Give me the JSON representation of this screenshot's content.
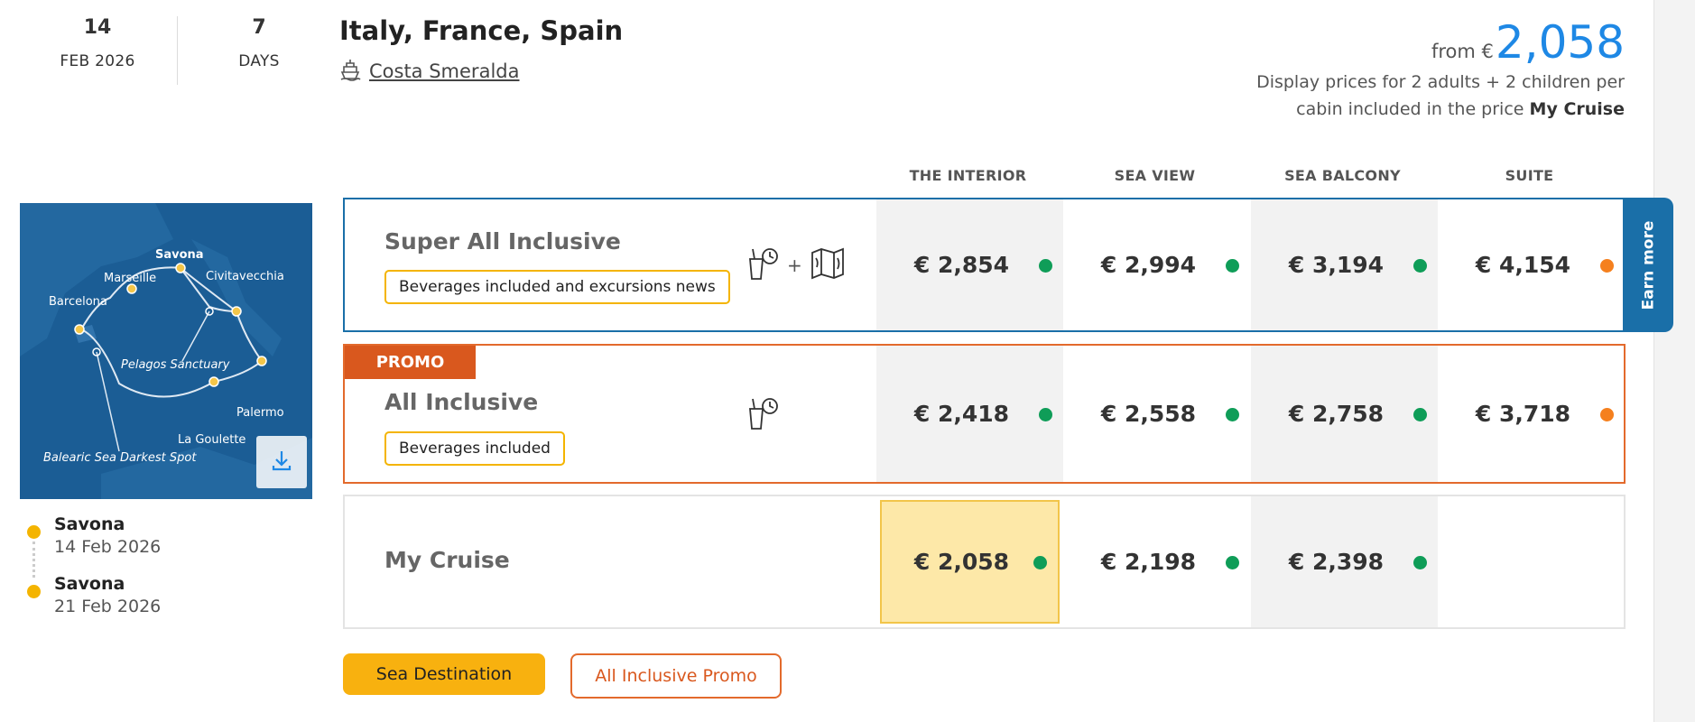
{
  "colors": {
    "accent_blue": "#1e88e5",
    "brand_navy": "#1a6fa8",
    "promo_orange": "#d9581e",
    "tag_yellow": "#f4b400",
    "available_green": "#0f9d58",
    "limited_orange": "#f5801e"
  },
  "header": {
    "departure_day": "14",
    "departure_month": "FEB 2026",
    "duration": "7",
    "duration_unit": "DAYS",
    "title": "Italy, France, Spain",
    "ship_icon": "ship-icon",
    "ship_name": "Costa Smeralda"
  },
  "price_summary": {
    "from_label": "from €",
    "from_price": "2,058",
    "note_text": "Display prices for 2 adults + 2 children per cabin included in the price",
    "note_bold": "My Cruise"
  },
  "columns": [
    "THE INTERIOR",
    "SEA VIEW",
    "SEA BALCONY",
    "SUITE"
  ],
  "map": {
    "labels": {
      "savona": "Savona",
      "marseille": "Marseille",
      "civitavecchia": "Civitavecchia",
      "barcelona": "Barcelona",
      "pelagos": "Pelagos Sanctuary",
      "palermo": "Palermo",
      "goulette": "La Goulette",
      "balearic": "Balearic Sea Darkest Spot"
    },
    "download_icon": "download-icon"
  },
  "itinerary": [
    {
      "port": "Savona",
      "date": "14 Feb 2026"
    },
    {
      "port": "Savona",
      "date": "21 Feb 2026"
    }
  ],
  "packages": {
    "super": {
      "title": "Super All Inclusive",
      "tag": "Beverages included and excursions news",
      "plus": "+",
      "prices": [
        "€ 2,854",
        "€ 2,994",
        "€ 3,194",
        "€ 4,154"
      ],
      "status": [
        "available",
        "available",
        "available",
        "limited"
      ]
    },
    "allinc": {
      "badge": "PROMO",
      "title": "All Inclusive",
      "tag": "Beverages included",
      "prices": [
        "€ 2,418",
        "€ 2,558",
        "€ 2,758",
        "€ 3,718"
      ],
      "status": [
        "available",
        "available",
        "available",
        "limited"
      ]
    },
    "mycruise": {
      "title": "My Cruise",
      "prices": [
        "€ 2,058",
        "€ 2,198",
        "€ 2,398"
      ],
      "status": [
        "available",
        "available",
        "available"
      ]
    }
  },
  "earn_more": "Earn more",
  "filters": {
    "sea_destination": "Sea Destination",
    "all_inclusive_promo": "All Inclusive Promo"
  }
}
